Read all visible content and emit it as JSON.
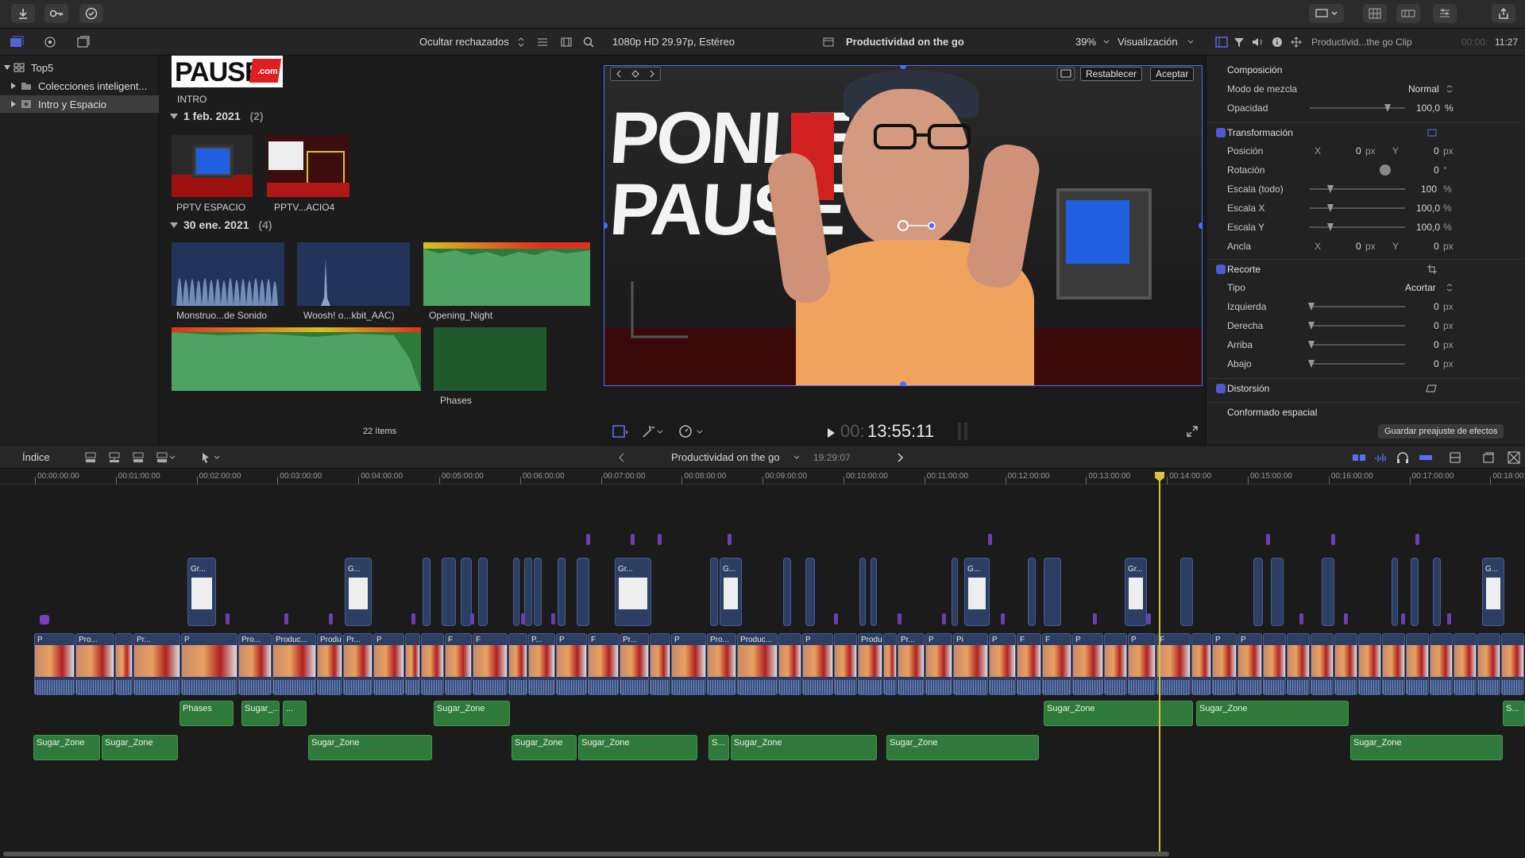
{
  "libraries": {
    "root": "Top5",
    "items": [
      {
        "label": "Colecciones inteligent..."
      },
      {
        "label": "Intro y Espacio"
      }
    ]
  },
  "browser": {
    "filter_label": "Ocultar rechazados",
    "top_clip_label": "INTRO",
    "logo_text": "PAUSE",
    "logo_sub": ".com",
    "groups": [
      {
        "date": "1 feb. 2021",
        "count": "(2)",
        "clips": [
          "PPTV ESPACIO",
          "PPTV...ACIO4"
        ]
      },
      {
        "date": "30 ene. 2021",
        "count": "(4)",
        "clips": [
          "Monstruo...de Sonido",
          "Woosh! o...kbit_AAC)",
          "Opening_Night",
          "Phases"
        ]
      }
    ],
    "items_count": "22 ítems"
  },
  "viewer": {
    "format": "1080p HD 29.97p, Estéreo",
    "project": "Productividad on the go",
    "zoom": "39%",
    "view_menu": "Visualización",
    "reset_button": "Restablecer",
    "accept_button": "Aceptar",
    "scene_text_1": "PONLE",
    "scene_text_2": "PAUSE",
    "timecode_dim": "00:",
    "timecode": "13:55:11"
  },
  "inspector": {
    "clip_name": "Productivid...the go Clip",
    "duration_dim": "00:00:",
    "duration": "11:27",
    "sections": {
      "composicion": "Composición",
      "modo_mezcla": "Modo de mezcla",
      "modo_val": "Normal",
      "opacidad": "Opacidad",
      "opacidad_val": "100,0",
      "transformacion": "Transformación",
      "posicion": "Posición",
      "rotacion": "Rotación",
      "escala_todo": "Escala (todo)",
      "escala_x": "Escala X",
      "escala_y": "Escala Y",
      "ancla": "Ancla",
      "recorte": "Recorte",
      "tipo": "Tipo",
      "tipo_val": "Acortar",
      "izquierda": "Izquierda",
      "derecha": "Derecha",
      "arriba": "Arriba",
      "abajo": "Abajo",
      "distorsion": "Distorsión",
      "conformado": "Conformado espacial"
    },
    "values": {
      "x_label": "X",
      "y_label": "Y",
      "zero": "0",
      "px": "px",
      "pct": "%",
      "deg": "°",
      "hundred": "100",
      "hundred_dec": "100,0"
    },
    "save_preset": "Guardar preajuste de efectos"
  },
  "timeline": {
    "index_label": "Índice",
    "project": "Productividad on the go",
    "duration": "19:29:07",
    "ruler": [
      "00:00:00:00",
      "00:01:00:00",
      "00:02:00:00",
      "00:03:00:00",
      "00:04:00:00",
      "00:05:00:00",
      "00:06:00:00",
      "00:07:00:00",
      "00:08:00:00",
      "00:09:00:00",
      "00:10:00:00",
      "00:11:00:00",
      "00:12:00:00",
      "00:13:00:00",
      "00:14:00:00",
      "00:15:00:00",
      "00:16:00:00",
      "00:17:00:00",
      "00:18:00:00"
    ],
    "story_labels": [
      "P",
      "Pro...",
      "Produc...",
      "Pr...",
      "P",
      "Pro...",
      "Produc...",
      "Produ...",
      "Pr...",
      "P",
      "Pi",
      "P",
      "F",
      "F",
      "P",
      "P...",
      "P",
      "F",
      "Pr...",
      "P"
    ],
    "connected_labels": [
      "Gr...",
      "G...",
      "Gr...",
      "G...",
      "G..."
    ],
    "audio_row1": [
      {
        "label": "Phases"
      },
      {
        "label": "Sugar_..."
      },
      {
        "label": "..."
      },
      {
        "label": "Sugar_Zone"
      },
      {
        "label": "Sugar_Zone"
      },
      {
        "label": "Sugar_Zone"
      },
      {
        "label": "S..."
      }
    ],
    "audio_row2": [
      {
        "label": "Sugar_Zone"
      },
      {
        "label": "Sugar_Zone"
      },
      {
        "label": "Sugar_Zone"
      },
      {
        "label": "Sugar_Zone"
      },
      {
        "label": "Sugar_Zone"
      },
      {
        "label": "S..."
      },
      {
        "label": "Sugar_Zone"
      },
      {
        "label": "Sugar_Zone"
      },
      {
        "label": "Sugar_Zone"
      }
    ]
  }
}
